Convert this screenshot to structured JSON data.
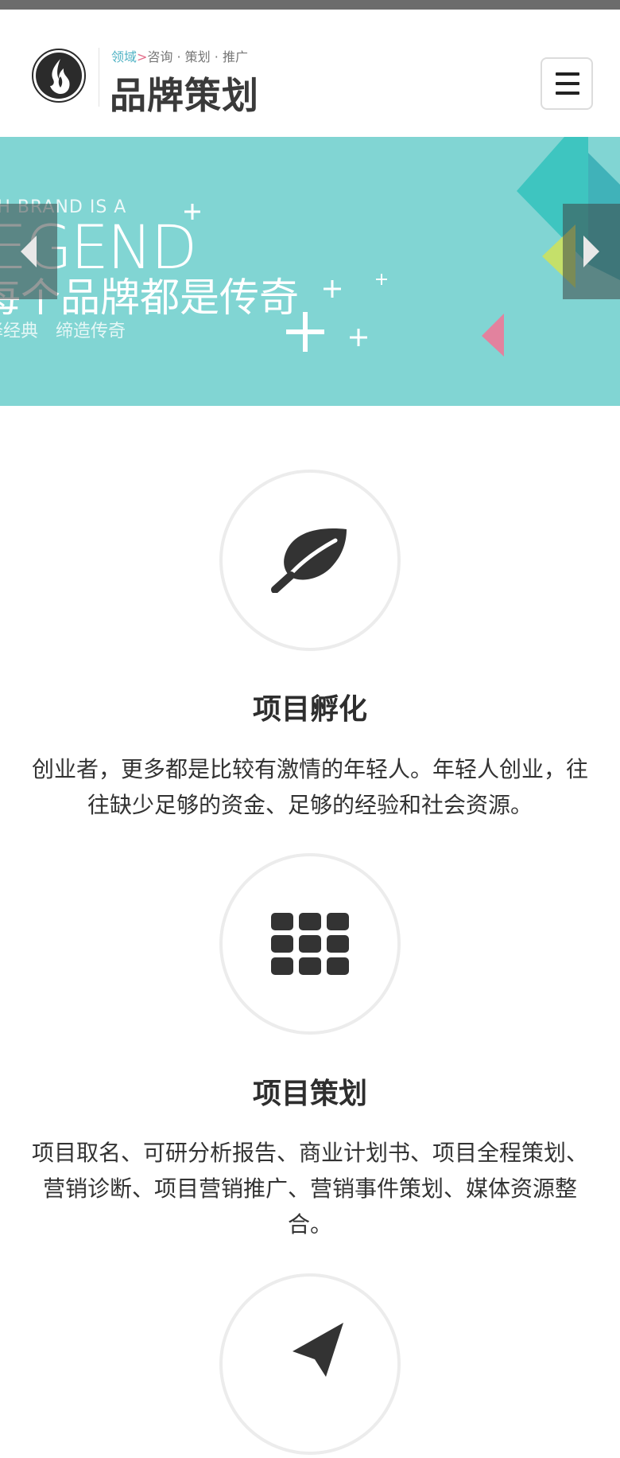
{
  "header": {
    "tagline_accent": "领域",
    "tagline_gt": ">",
    "tagline_rest": "咨询 · 策划 · 推广",
    "brand": "品牌策划",
    "logo_icon": "flame-icon",
    "menu_icon": "hamburger-menu-icon"
  },
  "banner": {
    "small_text": "CH BRAND IS A",
    "big_text": "EGEND",
    "cn_text": "每个品牌都是传奇",
    "sub_text": "择经典　缔造传奇",
    "prev_icon": "chevron-left-icon",
    "next_icon": "chevron-right-icon",
    "colors": {
      "bg": "#81d5d3",
      "teal": "#3ec5c0",
      "lime": "#c5e06a",
      "pink": "#e2829e"
    }
  },
  "features": [
    {
      "icon": "leaf-icon",
      "title": "项目孵化",
      "desc": "创业者，更多都是比较有激情的年轻人。年轻人创业，往往缺少足够的资金、足够的经验和社会资源。"
    },
    {
      "icon": "grid-icon",
      "title": "项目策划",
      "desc": "项目取名、可研分析报告、商业计划书、项目全程策划、营销诊断、项目营销推广、营销事件策划、媒体资源整合。"
    },
    {
      "icon": "send-icon"
    }
  ]
}
